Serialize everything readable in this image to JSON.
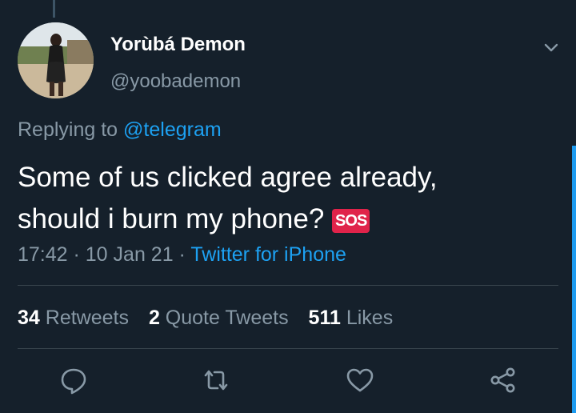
{
  "user": {
    "display_name": "Yorùbá Demon",
    "handle": "@yoobademon"
  },
  "reply": {
    "prefix": "Replying to ",
    "mention": "@telegram"
  },
  "tweet": {
    "line1": "Some of us clicked agree already,",
    "line2": "should i burn my phone? ",
    "emoji": "SOS"
  },
  "meta": {
    "time": "17:42",
    "sep1": " · ",
    "date": "10 Jan 21",
    "sep2": " · ",
    "source": "Twitter for iPhone"
  },
  "stats": {
    "retweets_count": "34",
    "retweets_label": "Retweets",
    "quotes_count": "2",
    "quotes_label": "Quote Tweets",
    "likes_count": "511",
    "likes_label": "Likes"
  },
  "icons": {
    "reply": "reply-icon",
    "retweet": "retweet-icon",
    "like": "like-icon",
    "share": "share-icon",
    "caret": "chevron-down-icon"
  },
  "colors": {
    "background": "#15202b",
    "accent": "#1da1f2",
    "muted": "#8899a6",
    "sos": "#e0234a"
  }
}
